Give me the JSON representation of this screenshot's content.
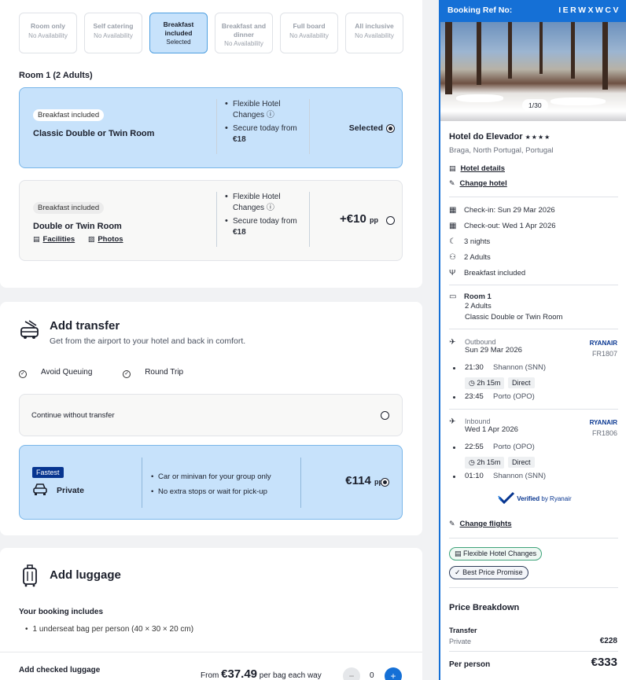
{
  "board_options": [
    {
      "name": "Room only",
      "status": "No Availability"
    },
    {
      "name": "Self catering",
      "status": "No Availability"
    },
    {
      "name": "Breakfast included",
      "status": "Selected"
    },
    {
      "name": "Breakfast and dinner",
      "status": "No Availability"
    },
    {
      "name": "Full board",
      "status": "No Availability"
    },
    {
      "name": "All inclusive",
      "status": "No Availability"
    }
  ],
  "room_section": {
    "title": "Room 1 (2 Adults)",
    "rooms": [
      {
        "badge": "Breakfast included",
        "name": "Classic Double or Twin Room",
        "feature1": "Flexible Hotel Changes",
        "feature2": "Secure today from",
        "feature2_price": "€18",
        "state": "Selected"
      },
      {
        "badge": "Breakfast included",
        "name": "Double or Twin Room",
        "feature1": "Flexible Hotel Changes",
        "feature2": "Secure today from",
        "feature2_price": "€18",
        "price": "+€10",
        "price_unit": "pp",
        "link_facilities": "Facilities",
        "link_photos": "Photos"
      }
    ]
  },
  "transfer": {
    "title": "Add transfer",
    "subtitle": "Get from the airport to your hotel and back in comfort.",
    "perks": [
      "Avoid Queuing",
      "Round Trip"
    ],
    "no_transfer_label": "Continue without transfer",
    "private": {
      "badge": "Fastest",
      "name": "Private",
      "features": [
        "Car or minivan for your group only",
        "No extra stops or wait for pick-up"
      ],
      "price": "€114",
      "price_unit": "pp"
    }
  },
  "luggage": {
    "title": "Add luggage",
    "includes_title": "Your booking includes",
    "includes_item": "1 underseat bag per person (40 × 30 × 20 cm)",
    "checked_title": "Add checked luggage",
    "from_prefix": "From",
    "from_price": "€37.49",
    "from_suffix": "per bag each way",
    "minus": "−",
    "quantity": "0",
    "plus": "+"
  },
  "summary": {
    "ref_label": "Booking Ref No:",
    "ref_value": "IERWXWCV",
    "photo_counter": "1/30",
    "hotel_name": "Hotel do Elevador",
    "stars": "★★★★",
    "location": "Braga, North Portugal, Portugal",
    "hotel_details_link": "Hotel details",
    "change_hotel_link": "Change hotel",
    "check_in": "Check-in: Sun 29 Mar 2026",
    "check_out": "Check-out: Wed 1 Apr 2026",
    "nights": "3 nights",
    "adults": "2 Adults",
    "board": "Breakfast included",
    "room_label": "Room 1",
    "room_adults": "2 Adults",
    "room_type": "Classic Double or Twin Room",
    "outbound": {
      "label": "Outbound",
      "date": "Sun 29 Mar 2026",
      "airline": "RYANAIR",
      "flight": "FR1807",
      "dep_time": "21:30",
      "dep_port": "Shannon (SNN)",
      "duration": "2h 15m",
      "stops": "Direct",
      "arr_time": "23:45",
      "arr_port": "Porto (OPO)"
    },
    "inbound": {
      "label": "Inbound",
      "date": "Wed 1 Apr 2026",
      "airline": "RYANAIR",
      "flight": "FR1806",
      "dep_time": "22:55",
      "dep_port": "Porto (OPO)",
      "duration": "2h 15m",
      "stops": "Direct",
      "arr_time": "01:10",
      "arr_port": "Shannon (SNN)"
    },
    "verified_label": "Verified",
    "verified_by": "by Ryanair",
    "change_flights_link": "Change flights",
    "pill_flex": "Flexible Hotel Changes",
    "pill_best": "Best Price Promise",
    "price_breakdown_title": "Price Breakdown",
    "transfer_label": "Transfer",
    "transfer_type": "Private",
    "transfer_price": "€228",
    "per_person_label": "Per person",
    "per_person_price": "€333"
  },
  "colors": {
    "accent": "#1570d6",
    "selected_bg": "#c7e2fb",
    "brand_navy": "#073590"
  }
}
